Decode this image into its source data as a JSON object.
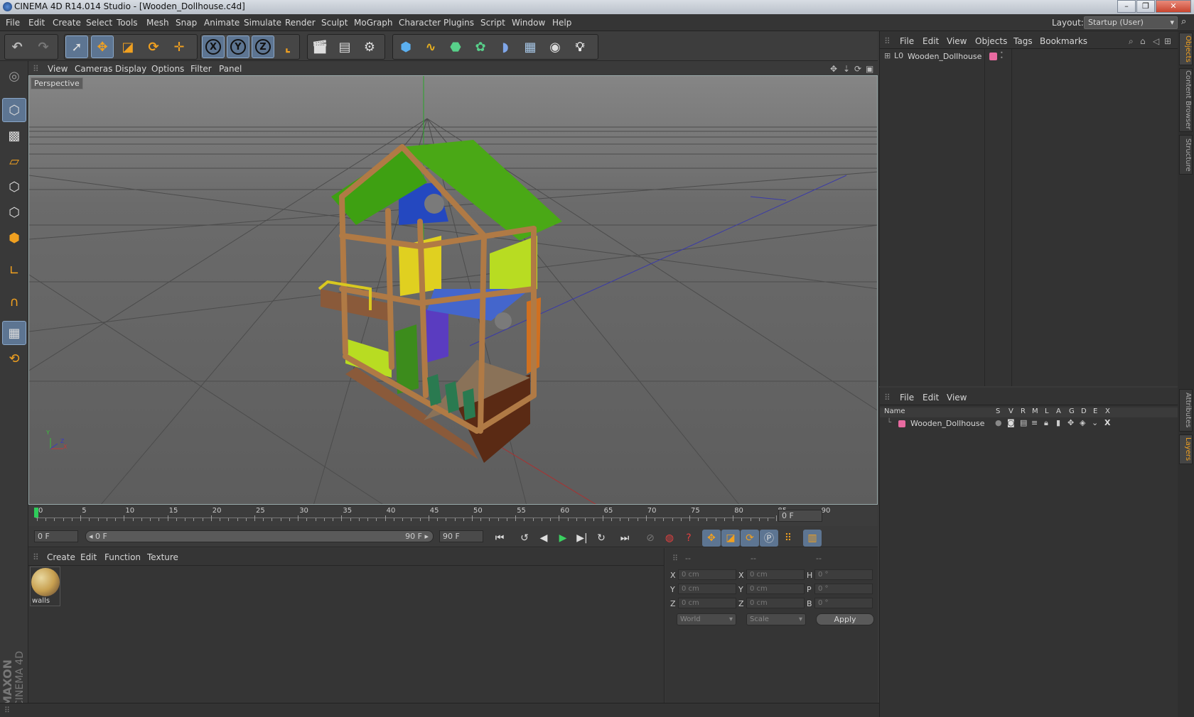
{
  "window": {
    "title": "CINEMA 4D R14.014 Studio - [Wooden_Dollhouse.c4d]",
    "buttons": [
      "–",
      "❐",
      "✕"
    ]
  },
  "menubar": {
    "items": [
      "File",
      "Edit",
      "Create",
      "Select",
      "Tools",
      "Mesh",
      "Snap",
      "Animate",
      "Simulate",
      "Render",
      "Sculpt",
      "MoGraph",
      "Character",
      "Plugins",
      "Script",
      "Window",
      "Help"
    ],
    "layout_label": "Layout:",
    "layout_value": "Startup (User)"
  },
  "viewport": {
    "menu": [
      "View",
      "Cameras",
      "Display",
      "Options",
      "Filter",
      "Panel"
    ],
    "label": "Perspective",
    "axis_y": "Y",
    "axis_x": "X",
    "axis_z": "Z"
  },
  "timeline": {
    "ticks": [
      "0",
      "5",
      "10",
      "15",
      "20",
      "25",
      "30",
      "35",
      "40",
      "45",
      "50",
      "55",
      "60",
      "65",
      "70",
      "75",
      "80",
      "85",
      "90"
    ],
    "frame_field": "0 F"
  },
  "transport": {
    "start_field": "0 F",
    "slider_start": "◂ 0 F",
    "slider_end": "90 F ▸",
    "end_field": "90 F"
  },
  "material_manager": {
    "menu": [
      "Create",
      "Edit",
      "Function",
      "Texture"
    ],
    "materials": [
      {
        "name": "walls"
      }
    ]
  },
  "coordinates": {
    "headers": [
      "--",
      "--",
      "--"
    ],
    "rows": [
      {
        "a": "X",
        "av": "0 cm",
        "b": "X",
        "bv": "0 cm",
        "c": "H",
        "cv": "0 °"
      },
      {
        "a": "Y",
        "av": "0 cm",
        "b": "Y",
        "bv": "0 cm",
        "c": "P",
        "cv": "0 °"
      },
      {
        "a": "Z",
        "av": "0 cm",
        "b": "Z",
        "bv": "0 cm",
        "c": "B",
        "cv": "0 °"
      }
    ],
    "world": "World",
    "scale": "Scale",
    "apply": "Apply"
  },
  "object_manager": {
    "menu": [
      "File",
      "Edit",
      "View",
      "Objects",
      "Tags",
      "Bookmarks"
    ],
    "object_name": "Wooden_Dollhouse"
  },
  "layer_manager": {
    "menu": [
      "File",
      "Edit",
      "View"
    ],
    "columns": [
      "Name",
      "S",
      "V",
      "R",
      "M",
      "L",
      "A",
      "G",
      "D",
      "E",
      "X"
    ],
    "layer_name": "Wooden_Dollhouse"
  },
  "side_tabs": [
    "Objects",
    "Content Browser",
    "Structure",
    "Attributes",
    "Layers"
  ],
  "branding": {
    "line1": "MAXON",
    "line2": "CINEMA 4D"
  },
  "colors": {
    "accent": "#5d7592",
    "layer_pink": "#e86aa0",
    "roof_green": "#3ea012",
    "wood": "#b07a45"
  }
}
